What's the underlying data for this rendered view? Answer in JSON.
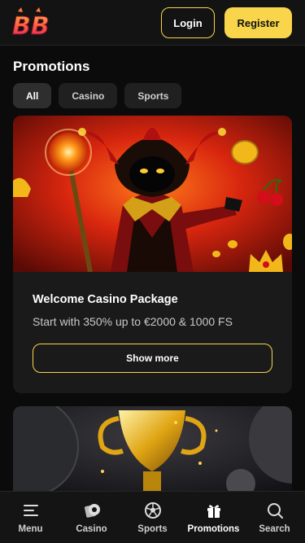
{
  "header": {
    "logo_text": "BB",
    "login_label": "Login",
    "register_label": "Register"
  },
  "page": {
    "title": "Promotions"
  },
  "tabs": [
    {
      "label": "All",
      "active": true
    },
    {
      "label": "Casino",
      "active": false
    },
    {
      "label": "Sports",
      "active": false
    }
  ],
  "promotions": [
    {
      "title": "Welcome Casino Package",
      "subtitle": "Start with 350% up to €2000 & 1000 FS",
      "button_label": "Show more"
    }
  ],
  "bottom_nav": [
    {
      "label": "Menu",
      "icon": "menu-icon"
    },
    {
      "label": "Casino",
      "icon": "casino-chip-icon"
    },
    {
      "label": "Sports",
      "icon": "soccer-ball-icon"
    },
    {
      "label": "Promotions",
      "icon": "gift-icon",
      "active": true
    },
    {
      "label": "Search",
      "icon": "search-icon"
    }
  ],
  "colors": {
    "accent": "#f8d54a",
    "background": "#0b0b0b",
    "card": "#1a1a1a"
  }
}
